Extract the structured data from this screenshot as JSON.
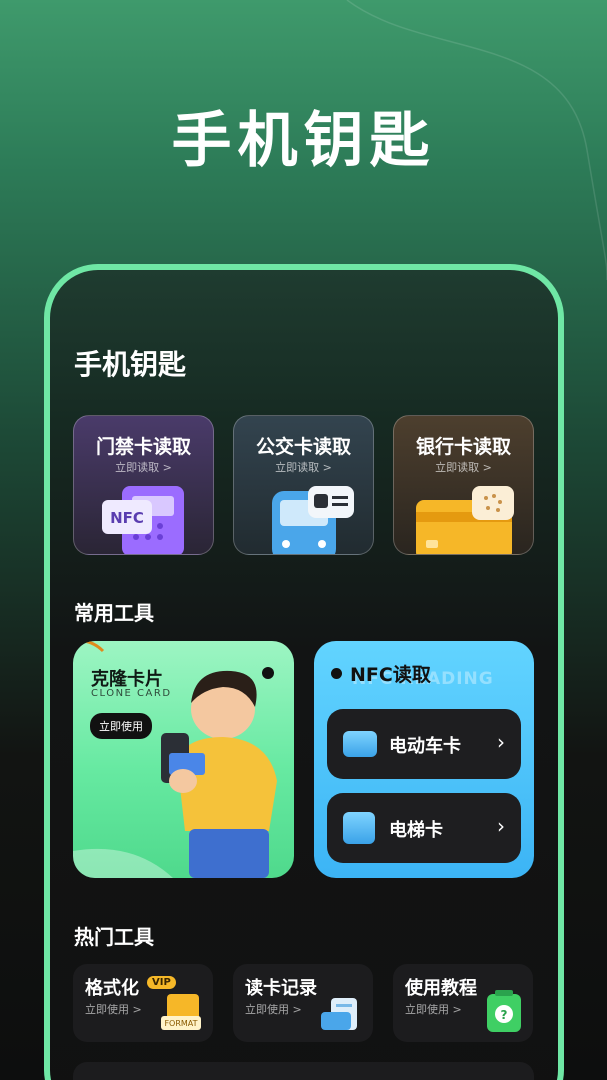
{
  "hero": {
    "title": "手机钥匙"
  },
  "app": {
    "title": "手机钥匙"
  },
  "top_cards": [
    {
      "title": "门禁卡读取",
      "sub": "立即读取 >",
      "icon": "nfc-door-card-icon"
    },
    {
      "title": "公交卡读取",
      "sub": "立即读取 >",
      "icon": "bus-icon"
    },
    {
      "title": "银行卡读取",
      "sub": "立即读取 >",
      "icon": "bank-card-icon"
    }
  ],
  "sections": {
    "common": "常用工具",
    "hot": "热门工具"
  },
  "clone": {
    "title": "克隆卡片",
    "en": "CLONE CARD",
    "button": "立即使用"
  },
  "nfc": {
    "title": "NFC读取",
    "ghost": "NFC READING",
    "rows": [
      {
        "label": "电动车卡",
        "icon": "scooter-icon"
      },
      {
        "label": "电梯卡",
        "icon": "elevator-icon"
      }
    ]
  },
  "hot_tools": [
    {
      "title": "格式化",
      "sub": "立即使用 >",
      "badge": "VIP",
      "icon_text": "FORMAT"
    },
    {
      "title": "读卡记录",
      "sub": "立即使用 >"
    },
    {
      "title": "使用教程",
      "sub": "立即使用 >",
      "icon_text": "?"
    }
  ],
  "icon_labels": {
    "nfc": "NFC"
  },
  "colors": {
    "accent_green": "#6fe7a5",
    "nfc_blue": "#3cb4f5",
    "vip_gold": "#f6b828"
  }
}
